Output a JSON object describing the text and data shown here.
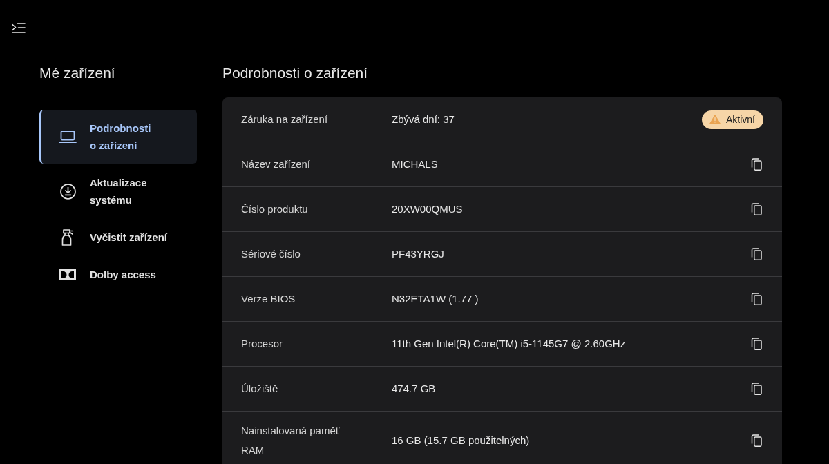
{
  "sidebar": {
    "title": "Mé zařízení",
    "items": [
      {
        "label": "Podrobnosti o zařízení",
        "selected": true
      },
      {
        "label": "Aktualizace systému",
        "selected": false
      },
      {
        "label": "Vyčistit zařízení",
        "selected": false
      },
      {
        "label": "Dolby access",
        "selected": false
      }
    ]
  },
  "details": {
    "title": "Podrobnosti o zařízení",
    "rows": [
      {
        "kind": "status",
        "label": "Záruka na zařízení",
        "value": "Zbývá dní: 37",
        "badge": "Aktivní"
      },
      {
        "kind": "copy",
        "label": "Název zařízení",
        "value": "MICHALS"
      },
      {
        "kind": "copy",
        "label": "Číslo produktu",
        "value": "20XW00QMUS"
      },
      {
        "kind": "copy",
        "label": "Sériové číslo",
        "value": "PF43YRGJ"
      },
      {
        "kind": "copy",
        "label": "Verze BIOS",
        "value": "N32ETA1W (1.77 )"
      },
      {
        "kind": "copy",
        "label": "Procesor",
        "value": "11th Gen Intel(R) Core(TM) i5-1145G7 @ 2.60GHz"
      },
      {
        "kind": "copy",
        "label": "Úložiště",
        "value": "474.7 GB"
      },
      {
        "kind": "copy",
        "label": "Nainstalovaná paměť RAM",
        "value": "16 GB (15.7 GB použitelných)"
      }
    ]
  }
}
